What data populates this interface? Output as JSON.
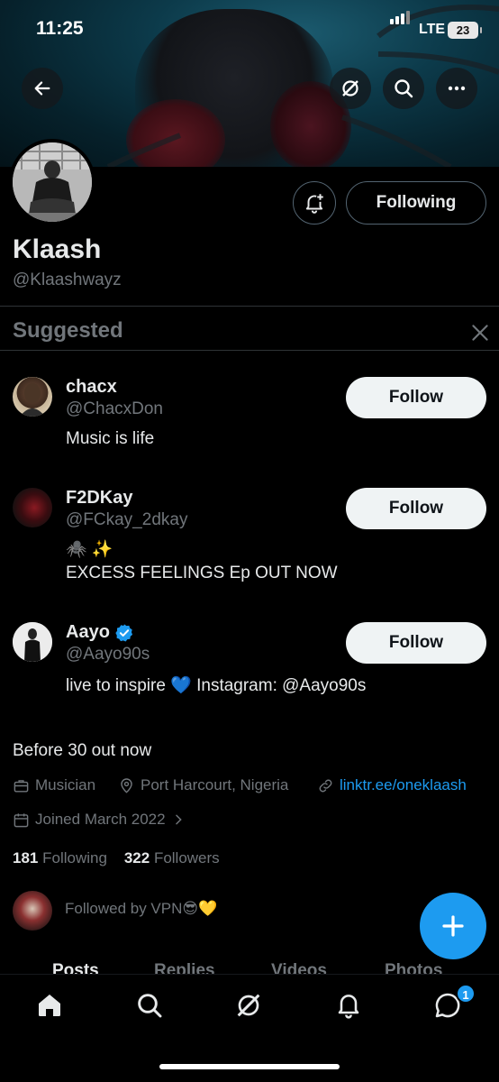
{
  "status_bar": {
    "time": "11:25",
    "network": "LTE",
    "battery": "23"
  },
  "header_actions": {
    "back_icon": "arrow-left-icon",
    "grok_icon": "grok-icon",
    "search_icon": "search-icon",
    "more_icon": "more-horizontal-icon"
  },
  "profile": {
    "name": "Klaash",
    "handle": "@Klaashwayz",
    "following_button": "Following",
    "bio": "Before 30 out now",
    "profession": "Musician",
    "location": "Port Harcourt, Nigeria",
    "link": "linktr.ee/oneklaash",
    "joined": "Joined March 2022",
    "following_count": "181",
    "following_label": "Following",
    "followers_count": "322",
    "followers_label": "Followers",
    "followed_by": "Followed by VPN😎💛"
  },
  "suggested": {
    "title": "Suggested",
    "items": [
      {
        "name": "chacx",
        "handle": "@ChacxDon",
        "bio": "Music is life",
        "bio2": "",
        "button": "Follow",
        "verified": false
      },
      {
        "name": "F2DKay",
        "handle": "@FCkay_2dkay",
        "bio": "🕷️ ✨",
        "bio2": "EXCESS FEELINGS Ep OUT NOW",
        "button": "Follow",
        "verified": false
      },
      {
        "name": "Aayo",
        "handle": "@Aayo90s",
        "bio": "live to inspire 💙 Instagram: @Aayo90s",
        "bio2": "",
        "button": "Follow",
        "verified": true
      }
    ]
  },
  "tabs": [
    "Posts",
    "Replies",
    "Videos",
    "Photos"
  ],
  "bottom_nav": {
    "items": [
      "home-icon",
      "search-icon",
      "grok-icon",
      "notifications-icon",
      "messages-icon"
    ],
    "messages_badge": "1"
  },
  "colors": {
    "accent": "#1d9bf0",
    "background": "#000000",
    "muted": "#71767b"
  }
}
